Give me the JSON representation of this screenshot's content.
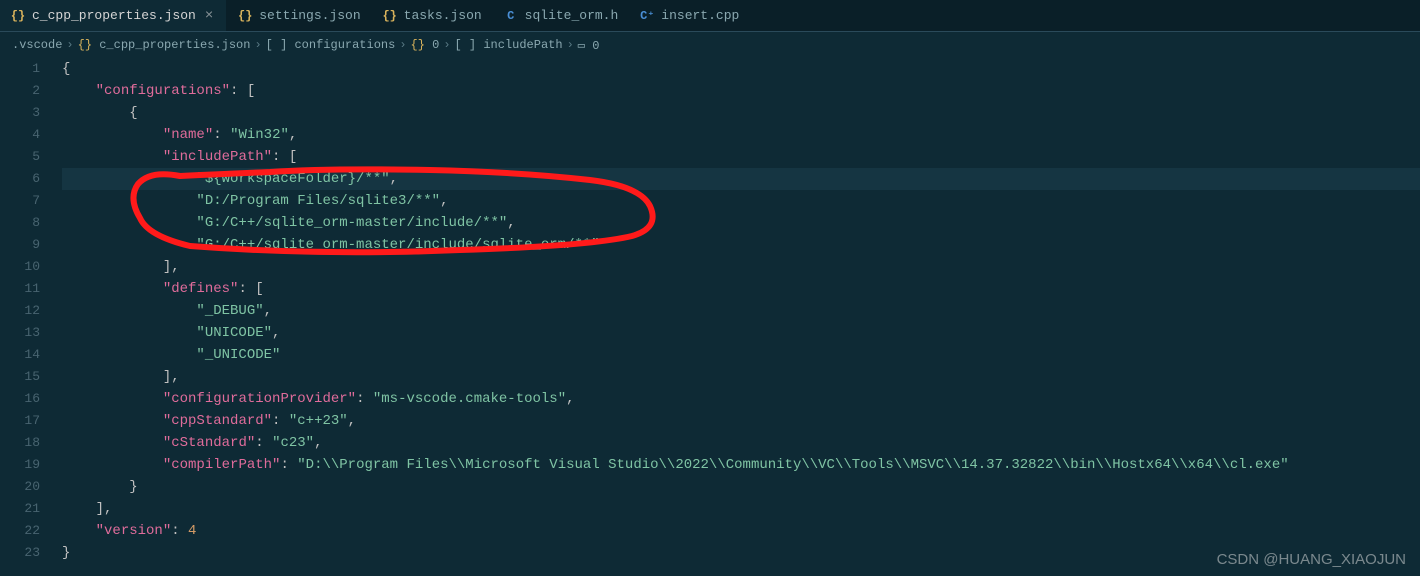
{
  "tabs": [
    {
      "label": "c_cpp_properties.json",
      "icon": "braces-yellow",
      "active": true
    },
    {
      "label": "settings.json",
      "icon": "braces-yellow",
      "active": false
    },
    {
      "label": "tasks.json",
      "icon": "braces-yellow",
      "active": false
    },
    {
      "label": "sqlite_orm.h",
      "icon": "c-blue",
      "active": false
    },
    {
      "label": "insert.cpp",
      "icon": "cpp-blue",
      "active": false
    }
  ],
  "breadcrumbs": [
    ".vscode",
    "c_cpp_properties.json",
    "configurations",
    "0",
    "includePath",
    "0"
  ],
  "breadcrumb_icons": [
    "",
    "braces",
    "array",
    "braces",
    "array",
    "symbol"
  ],
  "code_lines": [
    {
      "n": 1,
      "html": "<span class='brace'>{</span>"
    },
    {
      "n": 2,
      "html": "    <span class='key'>\"configurations\"</span><span class='punct'>:</span> <span class='brace'>[</span>"
    },
    {
      "n": 3,
      "html": "        <span class='brace'>{</span>"
    },
    {
      "n": 4,
      "html": "            <span class='key'>\"name\"</span><span class='punct'>:</span> <span class='string'>\"Win32\"</span><span class='punct'>,</span>"
    },
    {
      "n": 5,
      "html": "            <span class='key'>\"includePath\"</span><span class='punct'>:</span> <span class='brace'>[</span>"
    },
    {
      "n": 6,
      "html": "                <span class='string'>\"${workspaceFolder}/**\"</span><span class='punct'>,</span>"
    },
    {
      "n": 7,
      "html": "                <span class='string'>\"D:/Program Files/sqlite3/**\"</span><span class='punct'>,</span>"
    },
    {
      "n": 8,
      "html": "                <span class='string'>\"G:/C++/sqlite_orm-master/include/**\"</span><span class='punct'>,</span>"
    },
    {
      "n": 9,
      "html": "                <span class='string'>\"G:/C++/sqlite_orm-master/include/sqlite_orm/**\"</span>"
    },
    {
      "n": 10,
      "html": "            <span class='brace'>]</span><span class='punct'>,</span>"
    },
    {
      "n": 11,
      "html": "            <span class='key'>\"defines\"</span><span class='punct'>:</span> <span class='brace'>[</span>"
    },
    {
      "n": 12,
      "html": "                <span class='string'>\"_DEBUG\"</span><span class='punct'>,</span>"
    },
    {
      "n": 13,
      "html": "                <span class='string'>\"UNICODE\"</span><span class='punct'>,</span>"
    },
    {
      "n": 14,
      "html": "                <span class='string'>\"_UNICODE\"</span>"
    },
    {
      "n": 15,
      "html": "            <span class='brace'>]</span><span class='punct'>,</span>"
    },
    {
      "n": 16,
      "html": "            <span class='key'>\"configurationProvider\"</span><span class='punct'>:</span> <span class='string'>\"ms-vscode.cmake-tools\"</span><span class='punct'>,</span>"
    },
    {
      "n": 17,
      "html": "            <span class='key'>\"cppStandard\"</span><span class='punct'>:</span> <span class='string'>\"c++23\"</span><span class='punct'>,</span>"
    },
    {
      "n": 18,
      "html": "            <span class='key'>\"cStandard\"</span><span class='punct'>:</span> <span class='string'>\"c23\"</span><span class='punct'>,</span>"
    },
    {
      "n": 19,
      "html": "            <span class='key'>\"compilerPath\"</span><span class='punct'>:</span> <span class='string'>\"D:\\\\Program Files\\\\Microsoft Visual Studio\\\\2022\\\\Community\\\\VC\\\\Tools\\\\MSVC\\\\14.37.32822\\\\bin\\\\Hostx64\\\\x64\\\\cl.exe\"</span>"
    },
    {
      "n": 20,
      "html": "        <span class='brace'>}</span>"
    },
    {
      "n": 21,
      "html": "    <span class='brace'>]</span><span class='punct'>,</span>"
    },
    {
      "n": 22,
      "html": "    <span class='key'>\"version\"</span><span class='punct'>:</span> <span class='number'>4</span>"
    },
    {
      "n": 23,
      "html": "<span class='brace'>}</span>"
    }
  ],
  "highlighted_line": 6,
  "watermark": "CSDN @HUANG_XIAOJUN"
}
